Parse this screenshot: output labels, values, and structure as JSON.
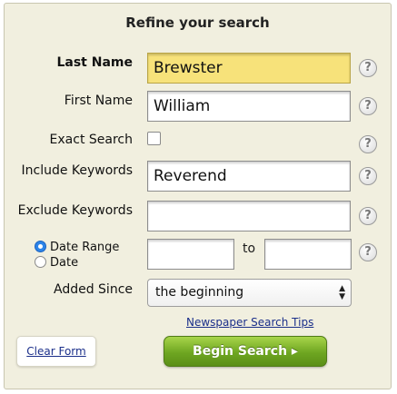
{
  "form": {
    "title": "Refine your search",
    "last_name": {
      "label": "Last Name",
      "value": "Brewster"
    },
    "first_name": {
      "label": "First Name",
      "value": "William"
    },
    "exact_search": {
      "label": "Exact Search",
      "checked": false
    },
    "include_keywords": {
      "label": "Include Keywords",
      "value": "Reverend"
    },
    "exclude_keywords": {
      "label": "Exclude Keywords",
      "value": ""
    },
    "date_mode": {
      "range_label": "Date Range",
      "single_label": "Date",
      "selected": "Date Range"
    },
    "date_from": "",
    "date_to": "",
    "to_label": "to",
    "added_since": {
      "label": "Added Since",
      "value": "the beginning"
    },
    "help_glyph": "?",
    "tips_link": "Newspaper Search Tips",
    "clear_button": "Clear Form",
    "begin_button": "Begin Search ▸"
  },
  "colors": {
    "panel_bg": "#f1efdf",
    "highlight_field": "#f7e27a",
    "link": "#1b2f8a",
    "primary_button": "#6ea621",
    "radio_selected": "#2c84e8"
  },
  "icons": {
    "help": "help-icon",
    "select_arrow": "select-arrow-icon"
  }
}
